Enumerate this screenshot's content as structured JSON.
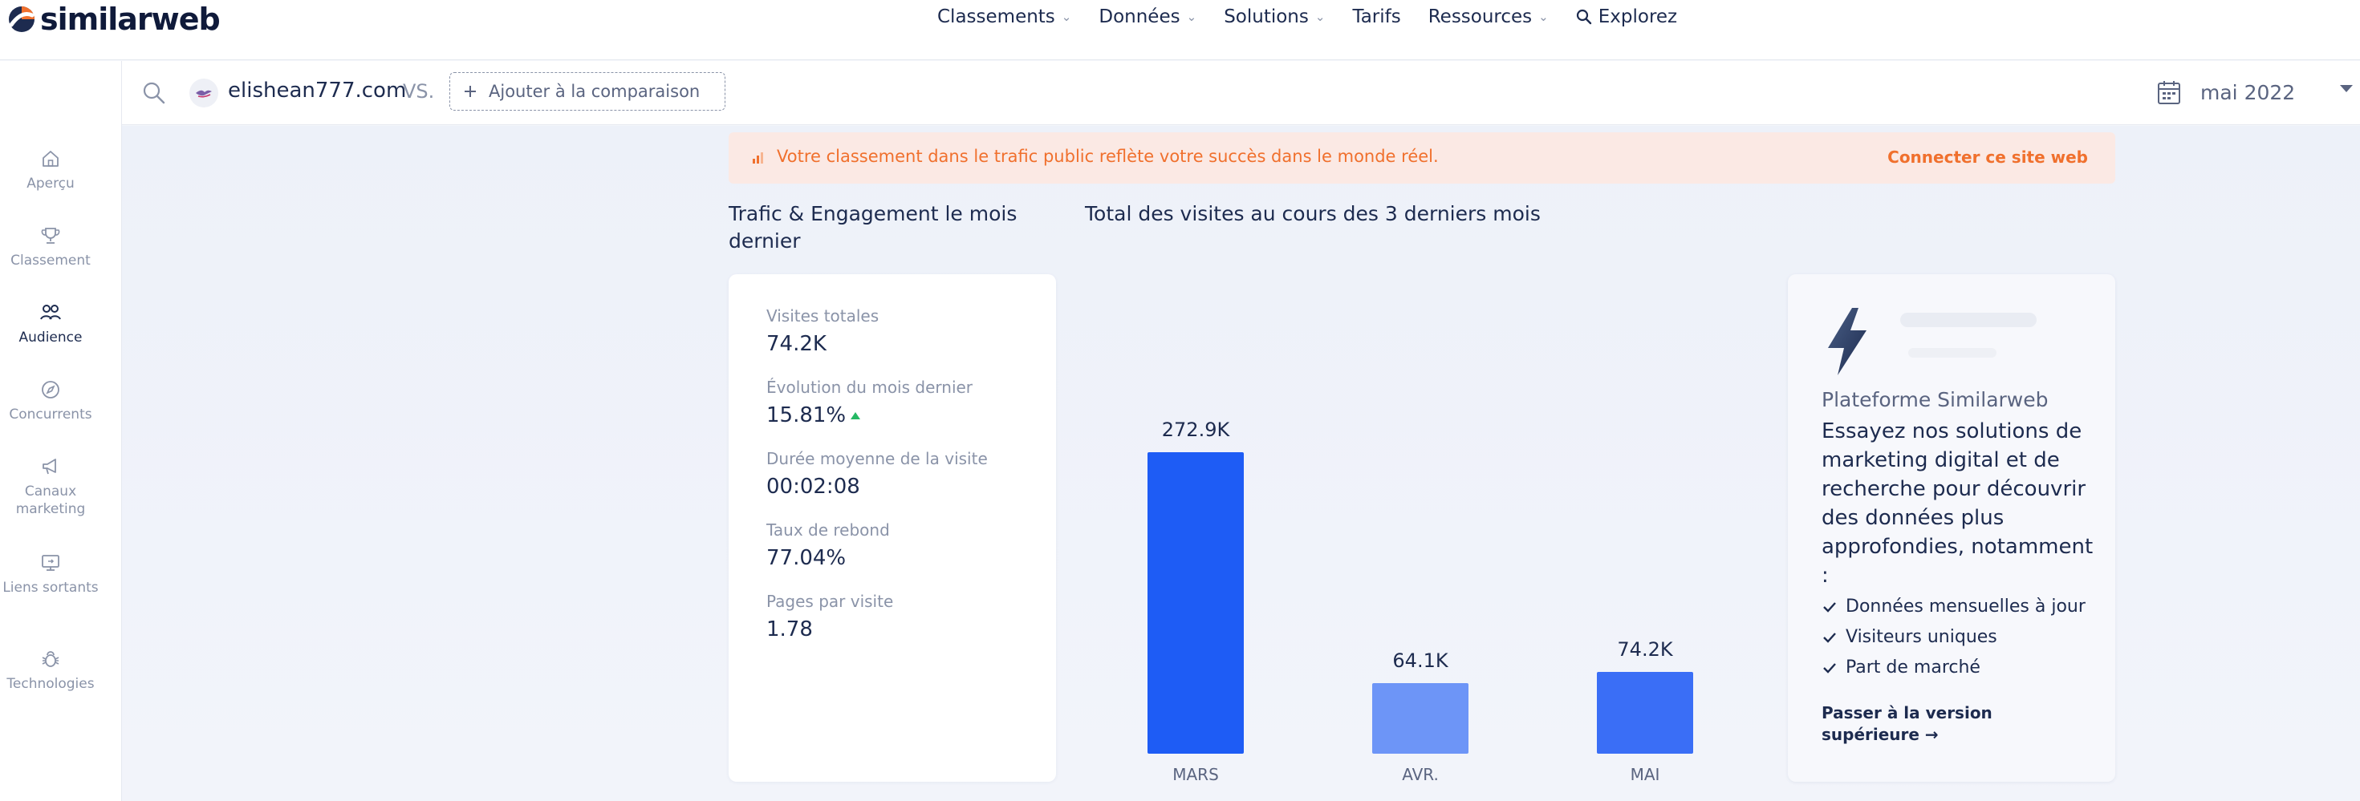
{
  "brand": {
    "name": "similarweb",
    "accent": "#f0702d",
    "primary_blue": "#1e5cf5"
  },
  "topnav": {
    "items": [
      {
        "label": "Classements",
        "has_dropdown": true
      },
      {
        "label": "Données",
        "has_dropdown": true
      },
      {
        "label": "Solutions",
        "has_dropdown": true
      },
      {
        "label": "Tarifs",
        "has_dropdown": false
      },
      {
        "label": "Ressources",
        "has_dropdown": true
      },
      {
        "label": "Explorez",
        "icon": "search-icon"
      }
    ]
  },
  "sidebar": {
    "items": [
      {
        "label": "Aperçu",
        "icon": "home-icon",
        "active": false
      },
      {
        "label": "Classement",
        "icon": "trophy-icon",
        "active": false
      },
      {
        "label": "Audience",
        "icon": "people-icon",
        "active": true
      },
      {
        "label": "Concurrents",
        "icon": "compass-icon",
        "active": false
      },
      {
        "label": "Canaux marketing",
        "icon": "megaphone-icon",
        "active": false
      },
      {
        "label": "Liens sortants",
        "icon": "monitor-link-icon",
        "active": false
      },
      {
        "label": "Technologies",
        "icon": "bug-icon",
        "active": false
      }
    ]
  },
  "searchbar": {
    "site": "elishean777.com",
    "vs": "VS.",
    "add_compare": "Ajouter à la comparaison",
    "date": "mai 2022"
  },
  "banner": {
    "text": "Votre classement dans le trafic public reflète votre succès dans le monde réel.",
    "link": "Connecter ce site web"
  },
  "traffic": {
    "title": "Trafic & Engagement le mois dernier",
    "metrics": [
      {
        "label": "Visites totales",
        "value": "74.2K"
      },
      {
        "label": "Évolution du mois dernier",
        "value": "15.81%",
        "trend": "up"
      },
      {
        "label": "Durée moyenne de la visite",
        "value": "00:02:08"
      },
      {
        "label": "Taux de rebond",
        "value": "77.04%"
      },
      {
        "label": "Pages par visite",
        "value": "1.78"
      }
    ]
  },
  "chart_data": {
    "type": "bar",
    "title": "Total des visites au cours des 3 derniers mois",
    "categories": [
      "MARS",
      "AVR.",
      "MAI"
    ],
    "values": [
      272.9,
      64.1,
      74.2
    ],
    "value_labels": [
      "272.9K",
      "64.1K",
      "74.2K"
    ],
    "unit": "K visits",
    "colors": [
      "#1e5cf5",
      "#6d95f7",
      "#3a6ef6"
    ],
    "ylim": [
      0,
      300
    ],
    "grid": false
  },
  "promo": {
    "subtitle": "Plateforme Similarweb",
    "headline": "Essayez nos solutions de marketing digital et de recherche pour découvrir des données plus approfondies, notamment :",
    "bullets": [
      "Données mensuelles à jour",
      "Visiteurs uniques",
      "Part de marché"
    ],
    "cta": "Passer à la version supérieure →"
  }
}
